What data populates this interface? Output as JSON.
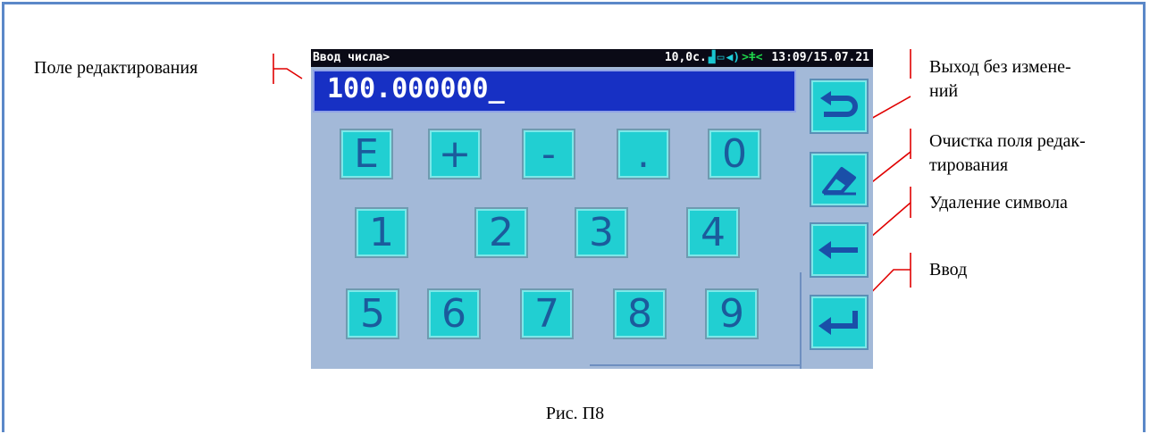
{
  "device": {
    "status": {
      "title": "Ввод числа>",
      "time_left": "10,0с.",
      "clock": "13:09/15.07.21"
    },
    "field_value": "100.000000_",
    "keys": {
      "row1": [
        "E",
        "+",
        "-",
        ".",
        "0"
      ],
      "row2": [
        "1",
        "2",
        "3",
        "4"
      ],
      "row3": [
        "5",
        "6",
        "7",
        "8",
        "9"
      ]
    },
    "icons": {
      "exit": "return-arrow-icon",
      "clear": "eraser-icon",
      "backspace": "left-arrow-icon",
      "enter": "enter-arrow-icon"
    }
  },
  "annotations": {
    "edit_field": "Поле редактирования",
    "exit_line1": "Выход без измене-",
    "exit_line2": "ний",
    "clear_line1": "Очистка поля редак-",
    "clear_line2": "тирования",
    "delete_char": "Удаление символа",
    "enter": "Ввод"
  },
  "caption": "Рис. П8",
  "colors": {
    "frame": "#5b88c8",
    "annotation_line": "#e00000",
    "screen_bg": "#a3b9d8",
    "key": "#21cfd2",
    "edit_field": "#1730c4"
  }
}
